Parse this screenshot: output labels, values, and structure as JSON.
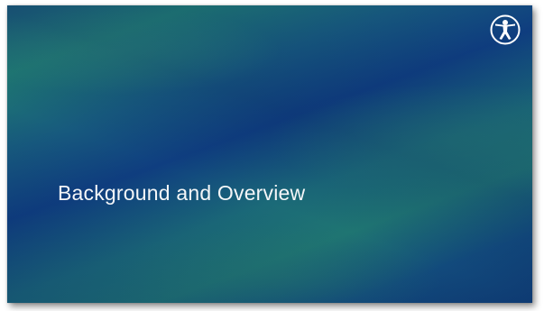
{
  "slide": {
    "title": "Background and Overview",
    "logo_icon": "vitruvian-figure-icon",
    "colors": {
      "background_teal": "#1f7a72",
      "background_blue": "#0f3e80",
      "title_text": "#f4f6f8"
    }
  }
}
